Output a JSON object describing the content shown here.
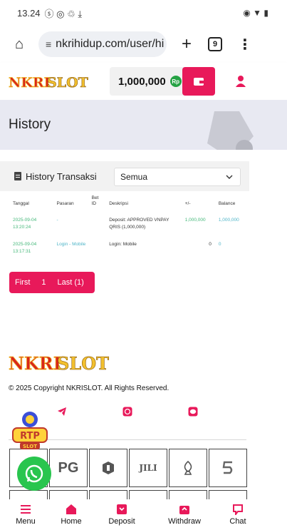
{
  "status_bar": {
    "time": "13.24",
    "left_icons": "ⓢ ◎ ♲ ⤓",
    "right_icons": "◉ ▼ ▮"
  },
  "browser": {
    "url": "nkrihidup.com/user/hi",
    "tab_count": "9",
    "plus_label": "+",
    "home_glyph": "⌂",
    "menu_glyph": "⋮",
    "tune_glyph": "≡"
  },
  "header": {
    "logo_text": "NKRISLOT",
    "balance": "1,000,000",
    "currency_badge": "Rp"
  },
  "hero": {
    "title": "History"
  },
  "history": {
    "card_title": "History Transaksi",
    "filter_value": "Semua",
    "columns": [
      "Tanggal",
      "Pasaran",
      "Bet ID",
      "Deskripsi",
      "+/-",
      "Balance"
    ],
    "rows": [
      {
        "tanggal": "2025-09-04 13:20:24",
        "pasaran": "-",
        "bet_id": "",
        "deskripsi": "Deposit: APPROVED VNPAY QRIS (1,000,000)",
        "amount": "1,000,000",
        "balance": "1,000,000"
      },
      {
        "tanggal": "2025-09-04 13:17:31",
        "pasaran": "Login - Mobile",
        "bet_id": "",
        "deskripsi": "Login: Mobile",
        "amount": "0",
        "balance": "0"
      }
    ]
  },
  "pager": {
    "first": "First",
    "page": "1",
    "last": "Last (1)"
  },
  "footer": {
    "logo_text": "NKRISLOT",
    "copyright": "© 2025 Copyright NKRISLOT. All Rights Reserved.",
    "providers": [
      "",
      "PG",
      "",
      "JILI",
      "",
      ""
    ],
    "rtp_text": "RTP SLOT"
  },
  "bottom_nav": [
    "Menu",
    "Home",
    "Deposit",
    "Withdraw",
    "Chat"
  ],
  "colors": {
    "accent": "#e8195a",
    "green": "#45b87a",
    "blue": "#4fb5c8",
    "hero_bg": "#e8e9f2"
  }
}
